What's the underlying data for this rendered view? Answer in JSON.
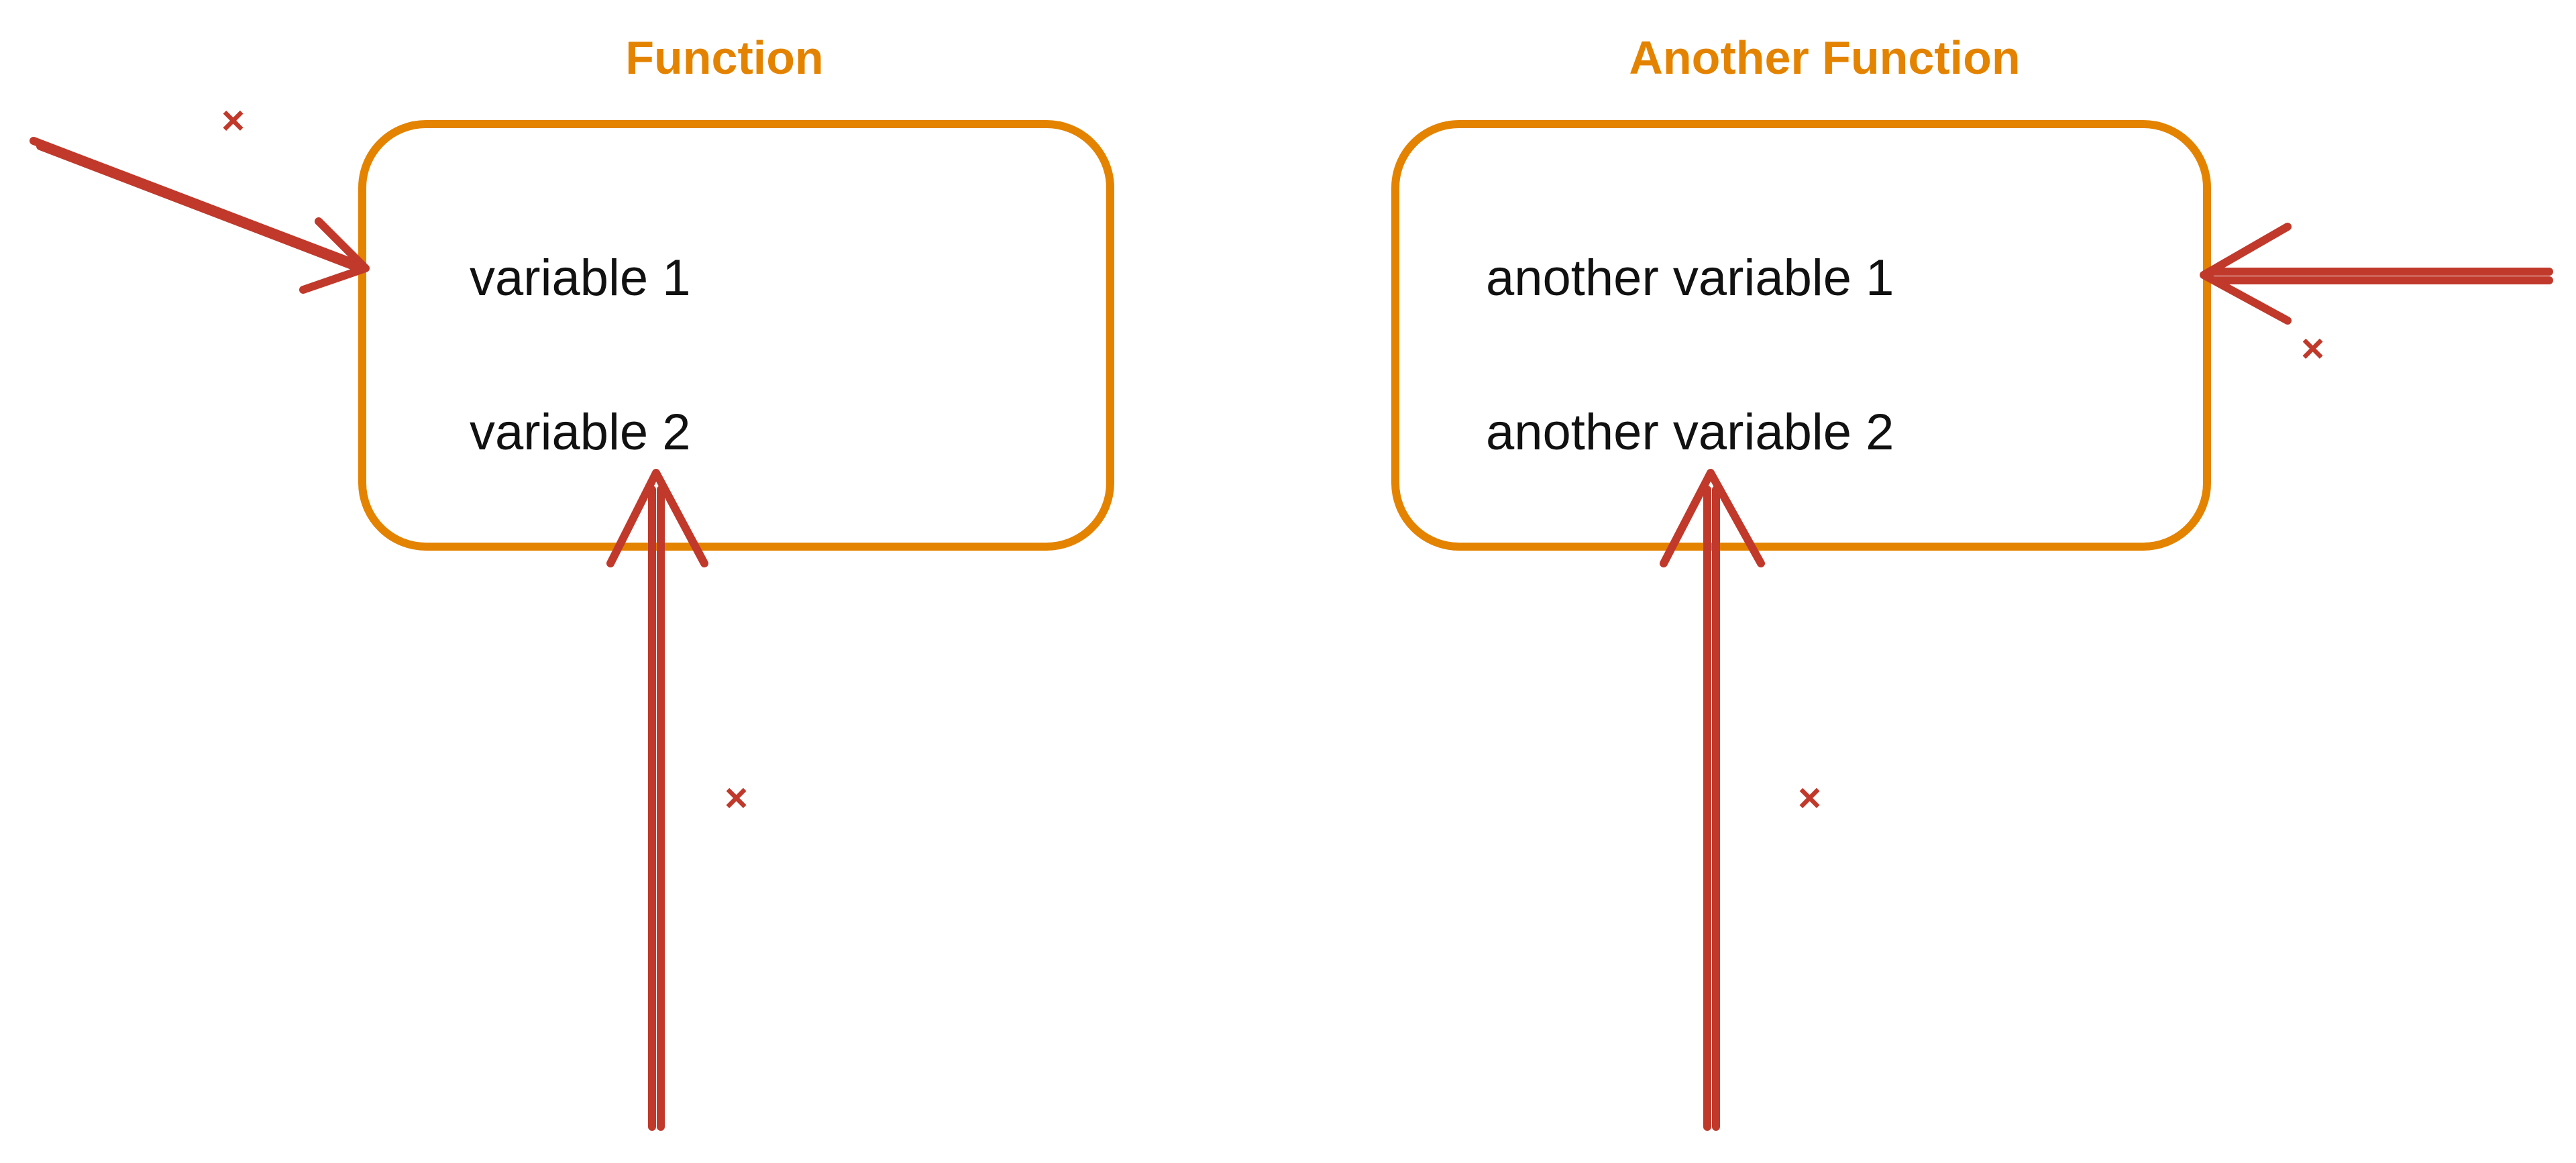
{
  "left": {
    "title": "Function",
    "var1": "variable 1",
    "var2": "variable 2"
  },
  "right": {
    "title": "Another Function",
    "var1": "another variable 1",
    "var2": "another variable 2"
  },
  "mark": "×",
  "colors": {
    "orange": "#e38300",
    "red": "#c0392b",
    "black": "#111111"
  }
}
